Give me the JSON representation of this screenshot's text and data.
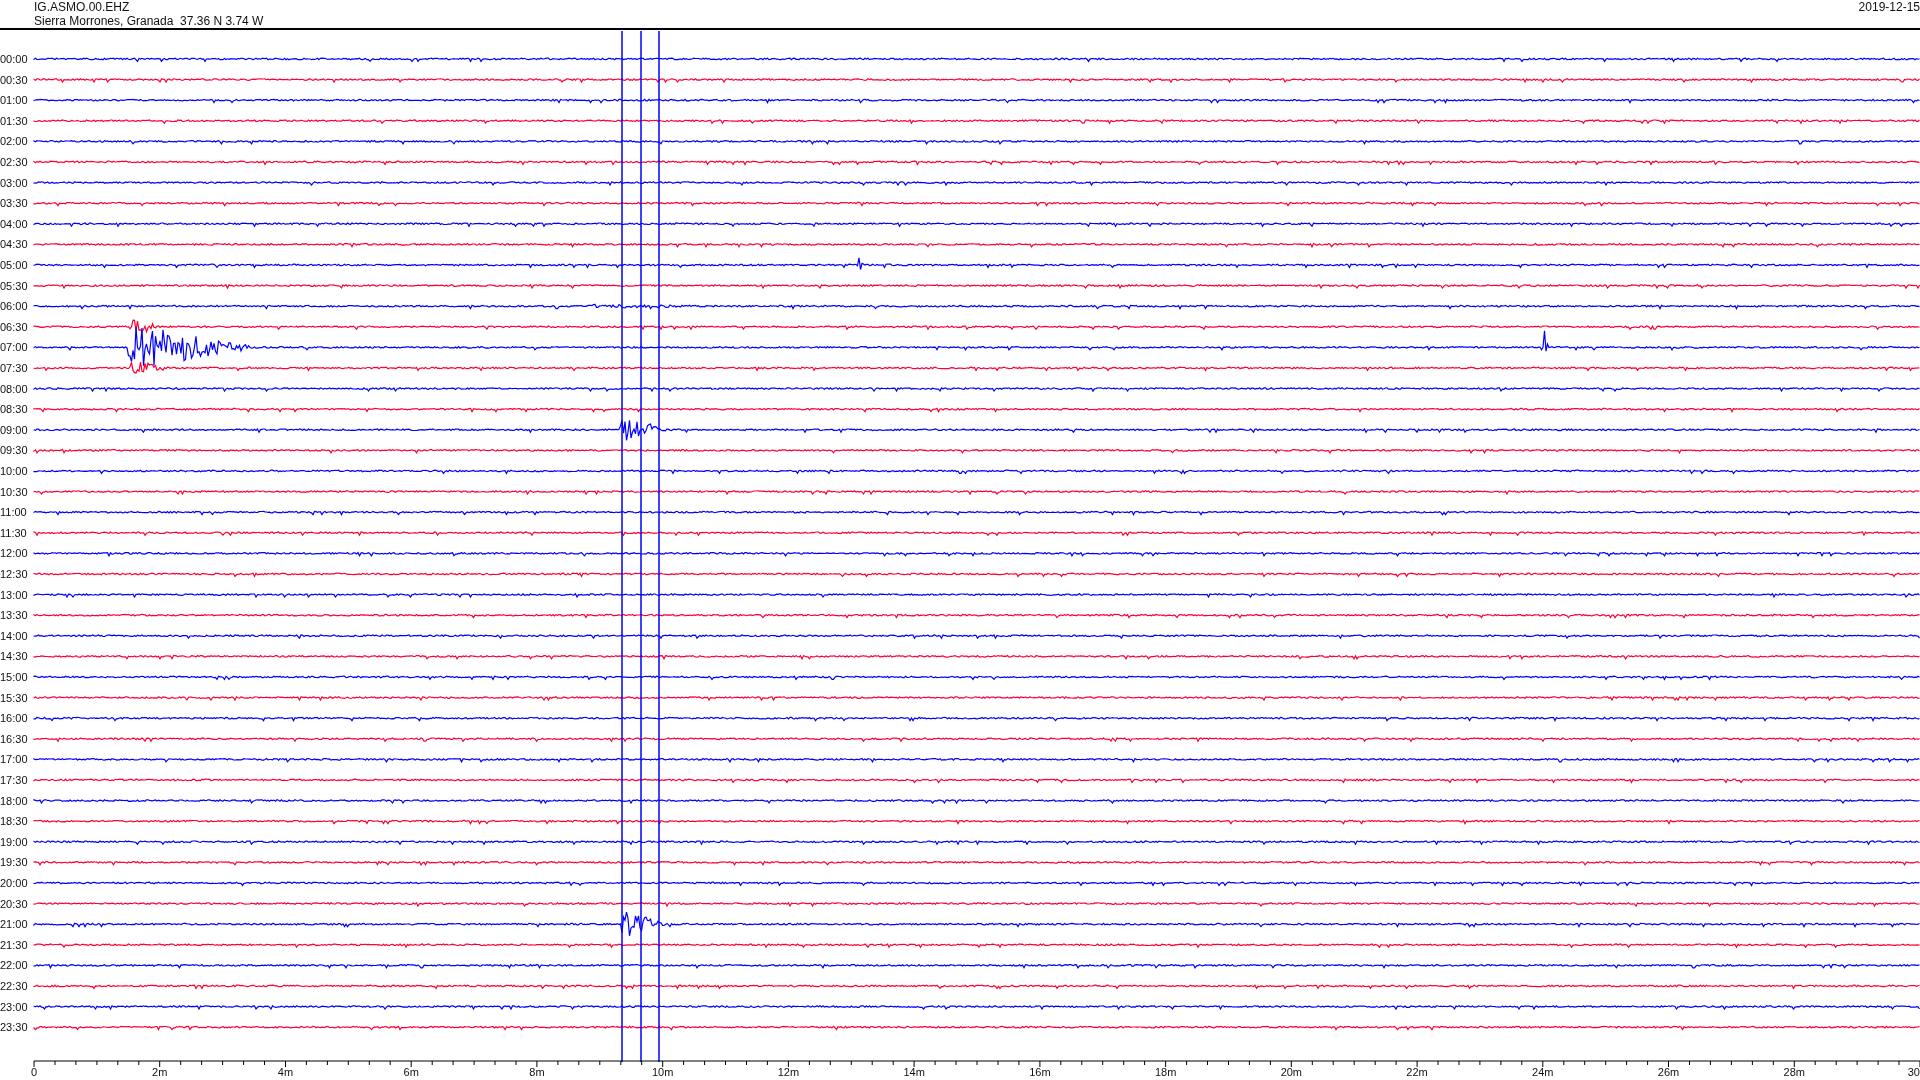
{
  "header": {
    "station": "IG.ASMO.00.EHZ",
    "location": "Sierra Morrones, Granada  37.36 N 3.74 W",
    "date": "2019-12-15"
  },
  "rows": [
    {
      "time": "00:00",
      "color": "#0000ff"
    },
    {
      "time": "00:30",
      "color": "#ff0033"
    },
    {
      "time": "01:00",
      "color": "#0000ff"
    },
    {
      "time": "01:30",
      "color": "#ff0033"
    },
    {
      "time": "02:00",
      "color": "#0000ff"
    },
    {
      "time": "02:30",
      "color": "#ff0033"
    },
    {
      "time": "03:00",
      "color": "#0000ff"
    },
    {
      "time": "03:30",
      "color": "#ff0033"
    },
    {
      "time": "04:00",
      "color": "#0000ff"
    },
    {
      "time": "04:30",
      "color": "#ff0033"
    },
    {
      "time": "05:00",
      "color": "#0000ff"
    },
    {
      "time": "05:30",
      "color": "#ff0033"
    },
    {
      "time": "06:00",
      "color": "#0000ff"
    },
    {
      "time": "06:30",
      "color": "#ff0033"
    },
    {
      "time": "07:00",
      "color": "#0000ff"
    },
    {
      "time": "07:30",
      "color": "#ff0033"
    },
    {
      "time": "08:00",
      "color": "#0000ff"
    },
    {
      "time": "08:30",
      "color": "#ff0033"
    },
    {
      "time": "09:00",
      "color": "#0000ff"
    },
    {
      "time": "09:30",
      "color": "#ff0033"
    },
    {
      "time": "10:00",
      "color": "#0000ff"
    },
    {
      "time": "10:30",
      "color": "#ff0033"
    },
    {
      "time": "11:00",
      "color": "#0000ff"
    },
    {
      "time": "11:30",
      "color": "#ff0033"
    },
    {
      "time": "12:00",
      "color": "#0000ff"
    },
    {
      "time": "12:30",
      "color": "#ff0033"
    },
    {
      "time": "13:00",
      "color": "#0000ff"
    },
    {
      "time": "13:30",
      "color": "#ff0033"
    },
    {
      "time": "14:00",
      "color": "#0000ff"
    },
    {
      "time": "14:30",
      "color": "#ff0033"
    },
    {
      "time": "15:00",
      "color": "#0000ff"
    },
    {
      "time": "15:30",
      "color": "#ff0033"
    },
    {
      "time": "16:00",
      "color": "#0000ff"
    },
    {
      "time": "16:30",
      "color": "#ff0033"
    },
    {
      "time": "17:00",
      "color": "#0000ff"
    },
    {
      "time": "17:30",
      "color": "#ff0033"
    },
    {
      "time": "18:00",
      "color": "#0000ff"
    },
    {
      "time": "18:30",
      "color": "#ff0033"
    },
    {
      "time": "19:00",
      "color": "#0000ff"
    },
    {
      "time": "19:30",
      "color": "#ff0033"
    },
    {
      "time": "20:00",
      "color": "#0000ff"
    },
    {
      "time": "20:30",
      "color": "#ff0033"
    },
    {
      "time": "21:00",
      "color": "#0000ff"
    },
    {
      "time": "21:30",
      "color": "#ff0033"
    },
    {
      "time": "22:00",
      "color": "#0000ff"
    },
    {
      "time": "22:30",
      "color": "#ff0033"
    },
    {
      "time": "23:00",
      "color": "#0000ff"
    },
    {
      "time": "23:30",
      "color": "#ff0033"
    }
  ],
  "axis": {
    "ticks": [
      "0",
      "2m",
      "4m",
      "6m",
      "8m",
      "10m",
      "12m",
      "14m",
      "16m",
      "18m",
      "20m",
      "22m",
      "24m",
      "26m",
      "28m",
      "30"
    ]
  }
}
